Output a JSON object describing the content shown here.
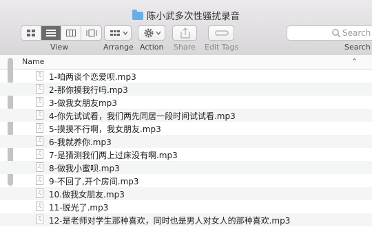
{
  "window": {
    "title": "陈小武多次性骚扰录音"
  },
  "toolbar": {
    "view_label": "View",
    "arrange_label": "Arrange",
    "action_label": "Action",
    "share_label": "Share",
    "edit_tags_label": "Edit Tags",
    "search_placeholder": "Search",
    "search_label": "Search"
  },
  "list": {
    "column_name": "Name",
    "files": [
      "1-咱两谈个恋爱呗.mp3",
      "2-那你摸我行吗.mp3",
      "3-做我女朋友mp3",
      "4-你先试试看，我们两先同居一段时间试试看.mp3",
      "5-摸摸不行啊，我女朋友.mp3",
      "6-我就养你.mp3",
      "7-是猜测我们两上过床没有啊.mp3",
      "8-做我小蜜呗.mp3",
      "9-不回了,开个房间.mp3",
      "10.做我女朋友.mp3",
      "11-脱光了.mp3",
      "12-是老师对学生那种喜欢，同时也是男人对女人的那种喜欢.mp3"
    ]
  }
}
